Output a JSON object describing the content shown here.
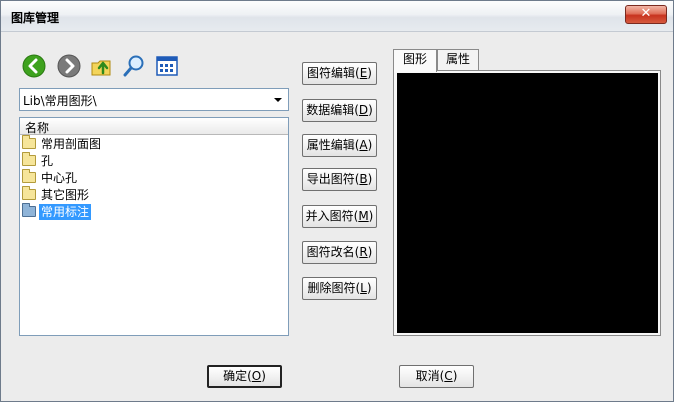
{
  "window": {
    "title": "图库管理",
    "close_glyph": "✕"
  },
  "toolbar": {
    "icons": [
      "back-icon",
      "forward-icon",
      "up-folder-icon",
      "search-icon",
      "view-grid-icon"
    ],
    "colors": {
      "back": "#3ea21e",
      "forward": "#6f6f6f",
      "up": "#e6b800",
      "search": "#2a6fb8",
      "grid": "#1e5bb8"
    }
  },
  "path_combo": {
    "value": "Lib\\常用图形\\"
  },
  "list": {
    "header": "名称",
    "items": [
      {
        "label": "常用剖面图",
        "selected": false
      },
      {
        "label": "孔",
        "selected": false
      },
      {
        "label": "中心孔",
        "selected": false
      },
      {
        "label": "其它图形",
        "selected": false
      },
      {
        "label": "常用标注",
        "selected": true
      }
    ]
  },
  "actions": [
    {
      "text": "图符编辑(",
      "hot": "E",
      "tail": ")"
    },
    {
      "text": "数据编辑(",
      "hot": "D",
      "tail": ")"
    },
    {
      "text": "属性编辑(",
      "hot": "A",
      "tail": ")"
    },
    {
      "text": "导出图符(",
      "hot": "B",
      "tail": ")"
    },
    {
      "text": "并入图符(",
      "hot": "M",
      "tail": ")"
    },
    {
      "text": "图符改名(",
      "hot": "R",
      "tail": ")"
    },
    {
      "text": "删除图符(",
      "hot": "L",
      "tail": ")"
    }
  ],
  "tabs": [
    {
      "label": "图形",
      "active": true
    },
    {
      "label": "属性",
      "active": false
    }
  ],
  "footer": {
    "ok": {
      "text": "确定(",
      "hot": "O",
      "tail": ")"
    },
    "cancel": {
      "text": "取消(",
      "hot": "C",
      "tail": ")"
    }
  }
}
